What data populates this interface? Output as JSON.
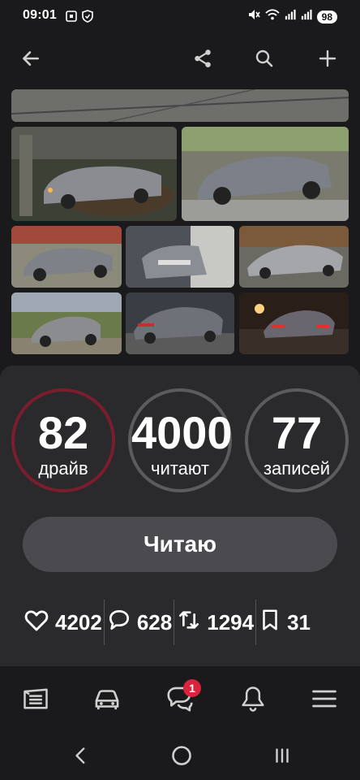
{
  "status_bar": {
    "time": "09:01",
    "battery": "98"
  },
  "stats": {
    "drive": {
      "value": "82",
      "label": "драйв"
    },
    "readers": {
      "value": "4000",
      "label": "читают"
    },
    "posts": {
      "value": "77",
      "label": "записей"
    }
  },
  "follow_button": {
    "label": "Читаю"
  },
  "metrics": {
    "likes": "4202",
    "comments": "628",
    "reposts": "1294",
    "bookmarks": "31"
  },
  "bottom_nav": {
    "notifications_badge": "1"
  },
  "colors": {
    "accent_red": "#7a1d2c",
    "badge_red": "#d8243c",
    "card_bg": "#2a2a2d",
    "button_bg": "#4a4a4f"
  }
}
